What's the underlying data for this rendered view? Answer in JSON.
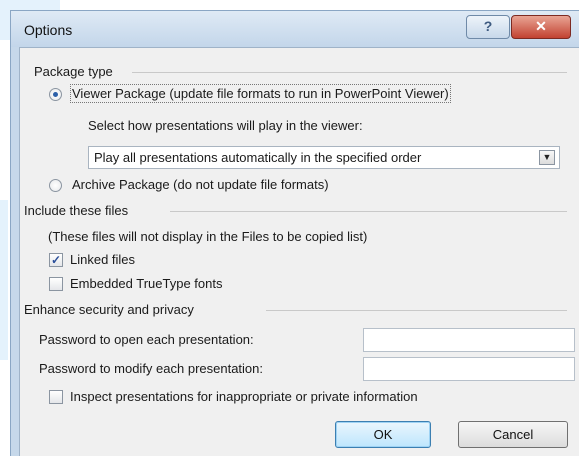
{
  "window": {
    "title": "Options",
    "help_label": "?",
    "close_label": "✕"
  },
  "package_type": {
    "group_label": "Package type",
    "viewer_option": "Viewer Package (update file formats to run in PowerPoint Viewer)",
    "viewer_selected": true,
    "play_label": "Select how presentations will play in the viewer:",
    "play_select": {
      "value": "Play all presentations automatically in the specified order",
      "arrow": "▼"
    },
    "archive_option": "Archive Package (do not update file formats)",
    "archive_selected": false
  },
  "include_files": {
    "group_label": "Include these files",
    "note": "(These files will not display in the Files to be copied list)",
    "linked_files": {
      "label": "Linked files",
      "checked": true
    },
    "embedded_fonts": {
      "label": "Embedded TrueType fonts",
      "checked": false
    }
  },
  "security": {
    "group_label": "Enhance security and privacy",
    "open_password_label": "Password to open each presentation:",
    "open_password_value": "",
    "modify_password_label": "Password to modify each presentation:",
    "modify_password_value": "",
    "inspect": {
      "label": "Inspect presentations for inappropriate or private information",
      "checked": false
    }
  },
  "buttons": {
    "ok": "OK",
    "cancel": "Cancel"
  },
  "colors": {
    "title_bar": "#c6d8ea",
    "close_button": "#c24231",
    "panel": "#f0f0f0",
    "check_mark": "#2b4f9a"
  }
}
